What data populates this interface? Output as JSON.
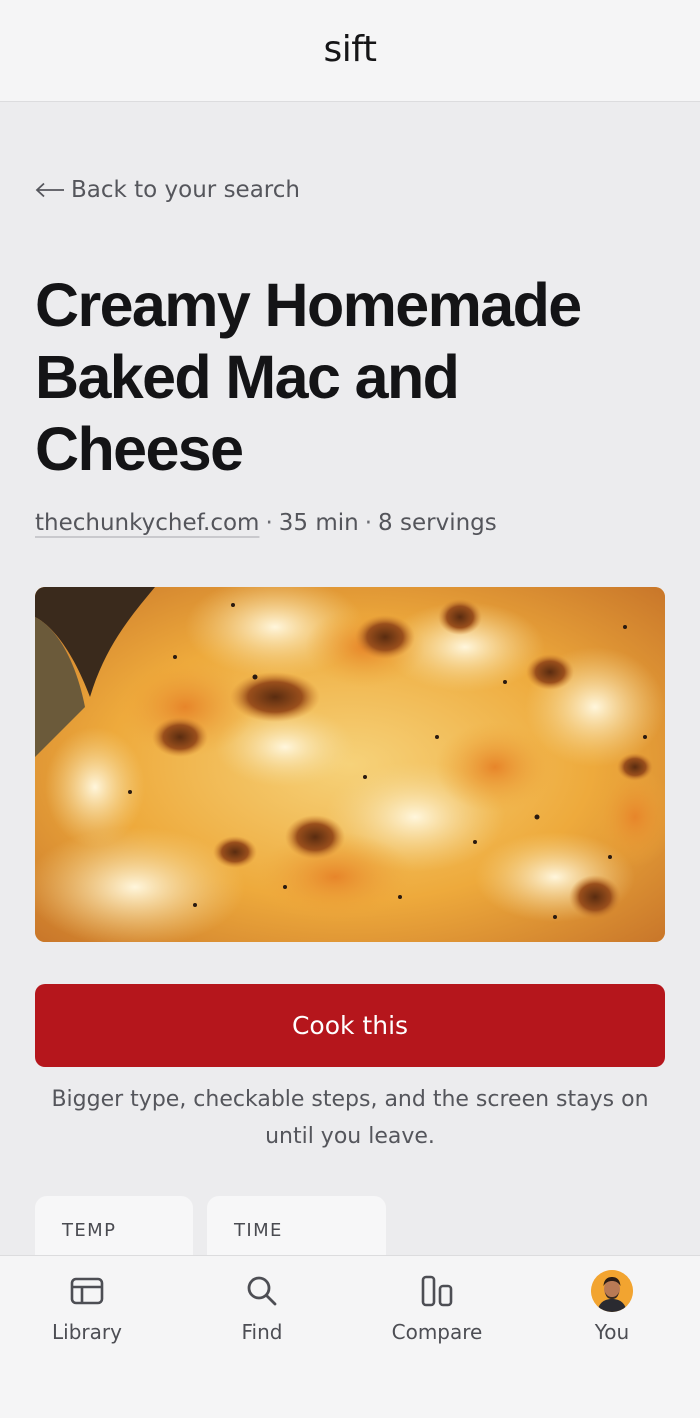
{
  "header": {
    "brand": "sift"
  },
  "navigation": {
    "back_label": "Back to your search",
    "back_icon": "arrow-left-icon"
  },
  "recipe": {
    "title": "Creamy Homemade Baked Mac and Cheese",
    "source": "thechunkychef.com",
    "separator": "·",
    "time": "35 min",
    "servings": "8 servings",
    "hero_image": "baked-mac-and-cheese-photo"
  },
  "cook": {
    "button_label": "Cook this",
    "button_color": "#b5161c",
    "note": "Bigger type, checkable steps, and the screen stays on until you leave."
  },
  "stats": [
    {
      "label": "TEMP"
    },
    {
      "label": "TIME"
    }
  ],
  "bottom_nav": [
    {
      "label": "Library",
      "icon": "library-icon"
    },
    {
      "label": "Find",
      "icon": "search-icon"
    },
    {
      "label": "Compare",
      "icon": "compare-icon"
    },
    {
      "label": "You",
      "icon": "avatar"
    }
  ],
  "colors": {
    "background": "#ececee",
    "header": "#f5f5f6",
    "accent": "#b5161c",
    "text": "#141416",
    "muted": "#55565c"
  }
}
